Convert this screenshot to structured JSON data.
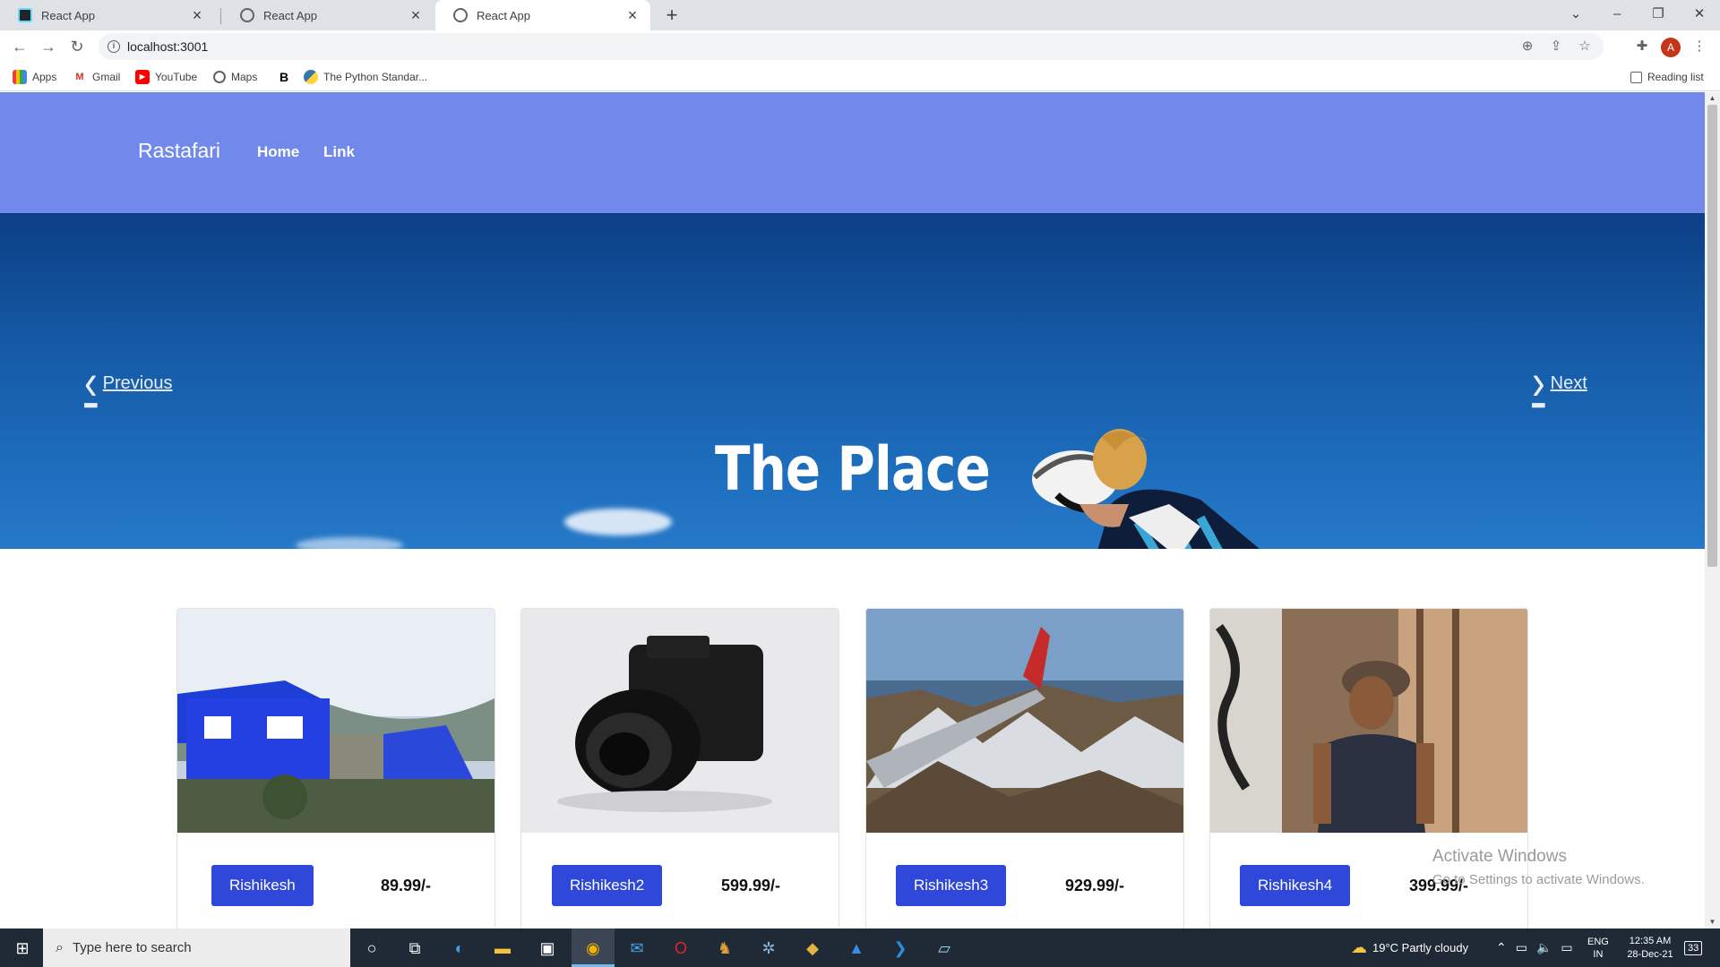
{
  "browser": {
    "tabs": [
      {
        "title": "React App",
        "active": false
      },
      {
        "title": "React App",
        "active": false
      },
      {
        "title": "React App",
        "active": true
      }
    ],
    "new_tab": "+",
    "url": "localhost:3001",
    "bookmarks": [
      {
        "label": "Apps",
        "icon": "apps-grid-icon"
      },
      {
        "label": "Gmail",
        "icon": "gmail-icon"
      },
      {
        "label": "YouTube",
        "icon": "youtube-icon"
      },
      {
        "label": "Maps",
        "icon": "maps-icon"
      },
      {
        "label": "",
        "icon": "bold-b-icon"
      },
      {
        "label": "The Python Standar...",
        "icon": "python-icon"
      }
    ],
    "reading_list": "Reading list",
    "profile_initial": "A"
  },
  "page": {
    "brand": "Rastafari",
    "nav": [
      "Home",
      "Link"
    ],
    "hero": {
      "title": "The Place",
      "prev": "Previous",
      "next": "Next"
    },
    "cards": [
      {
        "button": "Rishikesh",
        "price": "89.99/-",
        "image": "blue-house-image"
      },
      {
        "button": "Rishikesh2",
        "price": "599.99/-",
        "image": "camera-image"
      },
      {
        "button": "Rishikesh3",
        "price": "929.99/-",
        "image": "airplane-wing-image"
      },
      {
        "button": "Rishikesh4",
        "price": "399.99/-",
        "image": "woman-portrait-image"
      }
    ],
    "watermark": {
      "title": "Activate Windows",
      "subtitle": "Go to Settings to activate Windows."
    }
  },
  "taskbar": {
    "search_placeholder": "Type here to search",
    "weather": "19°C  Partly cloudy",
    "lang1": "ENG",
    "lang2": "IN",
    "time": "12:35 AM",
    "date": "28-Dec-21",
    "notifications": "33"
  },
  "colors": {
    "navbar": "#7189ea",
    "button": "#2f48d9",
    "hero_sky": "#155aa6"
  }
}
